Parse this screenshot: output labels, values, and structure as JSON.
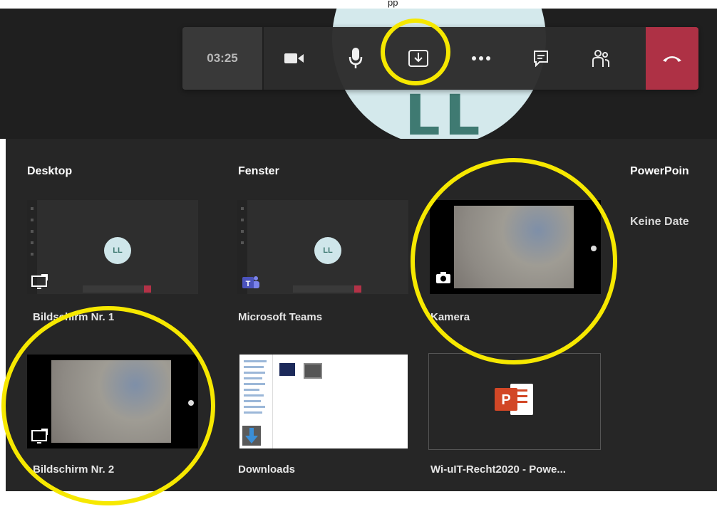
{
  "top_strip": {
    "text": "pp"
  },
  "avatar": {
    "initials": "LL"
  },
  "call_bar": {
    "timer": "03:25",
    "buttons": [
      {
        "name": "camera",
        "icon": "video-camera-icon"
      },
      {
        "name": "microphone",
        "icon": "microphone-icon"
      },
      {
        "name": "share-screen",
        "icon": "share-tray-icon"
      },
      {
        "name": "more",
        "icon": "ellipsis-icon"
      },
      {
        "name": "chat",
        "icon": "chat-icon"
      },
      {
        "name": "participants",
        "icon": "people-icon"
      },
      {
        "name": "hang-up",
        "icon": "phone-hangup-icon"
      }
    ],
    "hangup_color": "#b33247"
  },
  "share_panel": {
    "sections": {
      "desktop": "Desktop",
      "window": "Fenster",
      "powerpoint": "PowerPoin"
    },
    "powerpoint_empty": "Keine Date",
    "tiles": [
      {
        "label": "Bildschirm Nr. 1",
        "kind": "screen"
      },
      {
        "label": "Microsoft Teams",
        "kind": "window"
      },
      {
        "label": "Kamera",
        "kind": "window"
      },
      {
        "label": "Bildschirm Nr. 2",
        "kind": "screen"
      },
      {
        "label": "Downloads",
        "kind": "window"
      },
      {
        "label": "Wi-uIT-Recht2020 - Powe...",
        "kind": "window"
      }
    ],
    "mini_avatar_initials": "LL"
  },
  "annotation_color": "#f6e800"
}
